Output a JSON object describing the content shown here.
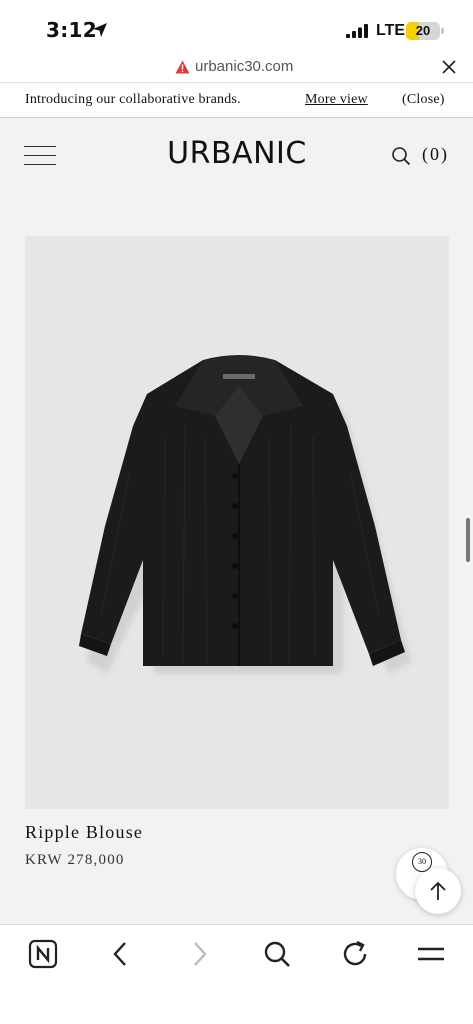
{
  "status_bar": {
    "time": "3:12",
    "network": "LTE",
    "battery_percent": 20,
    "battery_label": "20"
  },
  "browser": {
    "url": "urbanic30.com"
  },
  "banner": {
    "text": "Introducing our collaborative brands.",
    "more_link": "More view",
    "close_label": "(Close)"
  },
  "header": {
    "logo": "URBANIC",
    "cart_count": "(0)"
  },
  "product": {
    "name": "Ripple Blouse",
    "price": "KRW 278,000"
  },
  "floating": {
    "badge_label": "30"
  },
  "colors": {
    "battery_fill": "#f5d000",
    "warning": "#e53935",
    "page_bg": "#f2f2f2",
    "image_bg": "#e6e6e6"
  },
  "icons": [
    "location-arrow-icon",
    "signal-icon",
    "warning-icon",
    "close-icon",
    "hamburger-icon",
    "search-icon",
    "scroll-to-top-icon",
    "naver-icon",
    "back-icon",
    "forward-icon",
    "search-icon",
    "reload-icon",
    "menu-icon"
  ]
}
